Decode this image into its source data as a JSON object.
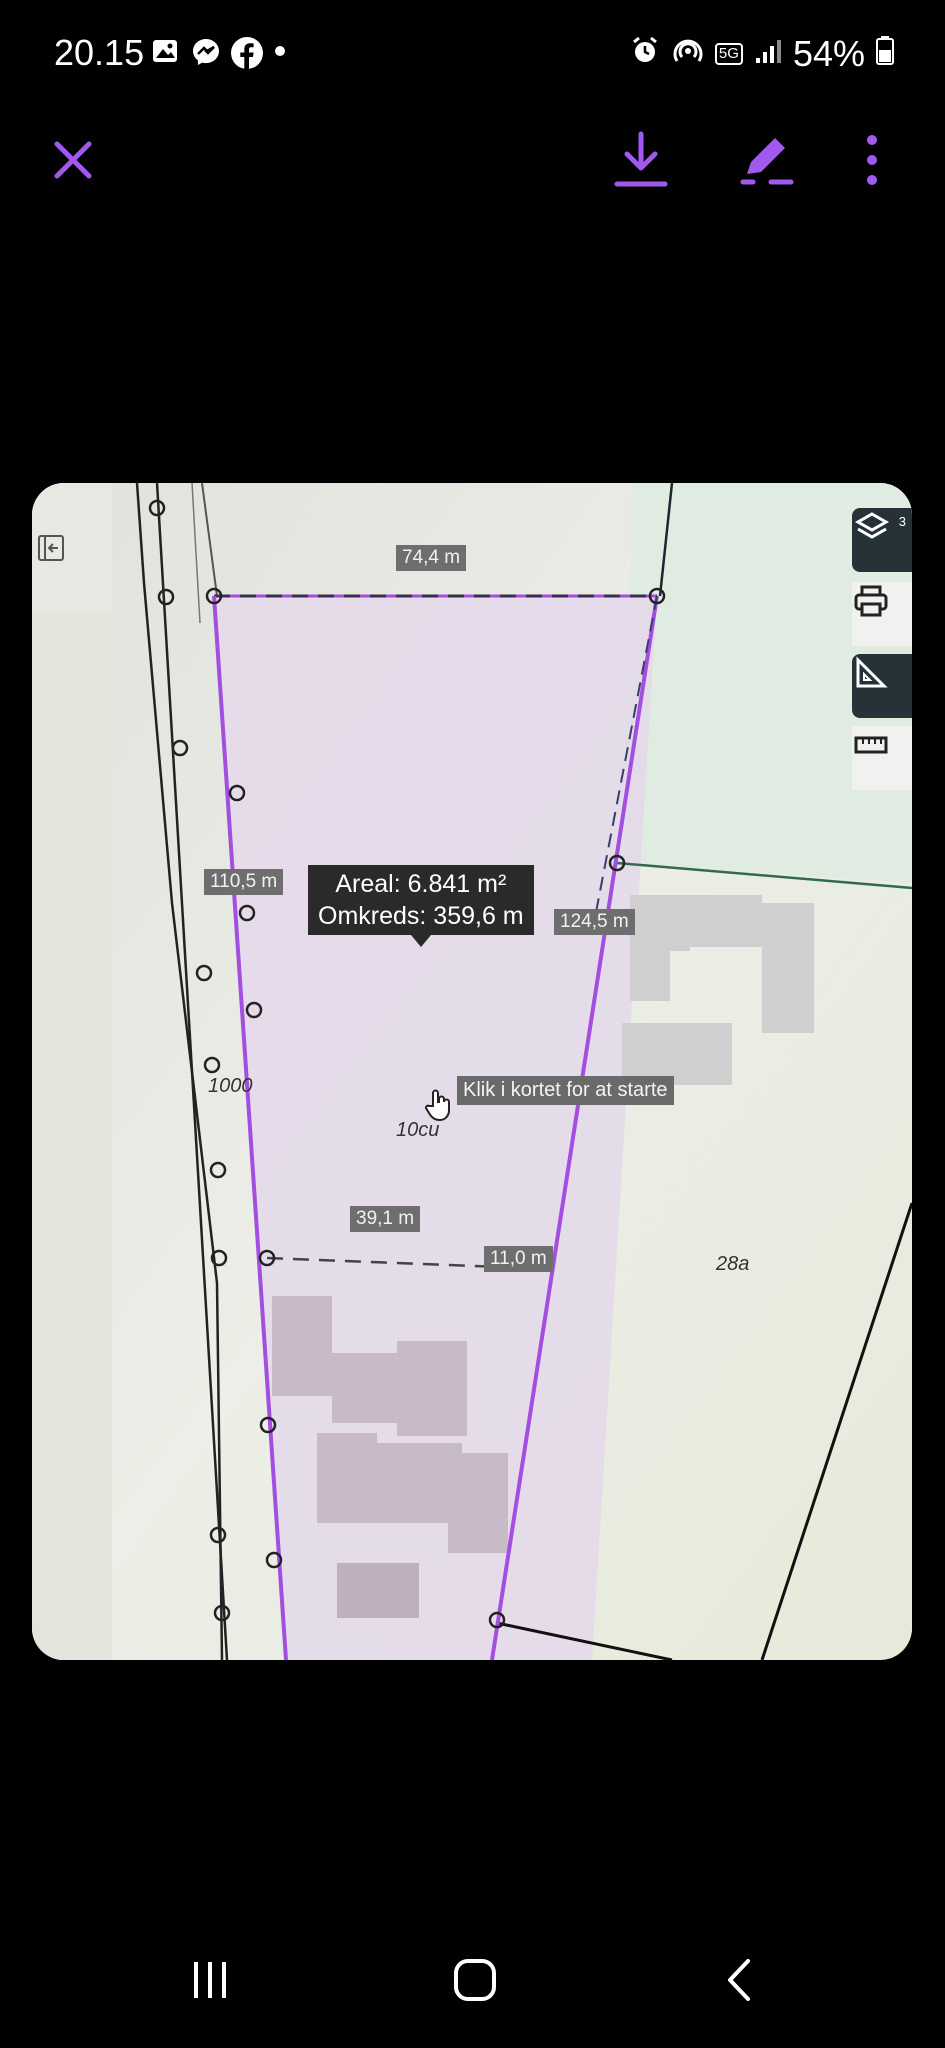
{
  "status": {
    "time": "20.15",
    "battery": "54%",
    "network": "5G",
    "icons": [
      "gallery-icon",
      "messenger-icon",
      "facebook-icon",
      "dot-icon",
      "alarm-icon",
      "hotspot-icon",
      "signal-icon",
      "battery-icon"
    ]
  },
  "toolbar": {
    "close_icon": "close-icon",
    "download_icon": "download-icon",
    "edit_icon": "edit-icon",
    "more_icon": "more-vert-icon",
    "accent": "#a259f0"
  },
  "map": {
    "dimension_labels": [
      "74,4 m",
      "110,5 m",
      "124,5 m",
      "39,1 m",
      "11,0 m"
    ],
    "area_label": "Areal: 6.841 m²",
    "perimeter_label": "Omkreds: 359,6 m",
    "hint": "Klik i kortet for at starte",
    "parcel_labels": [
      "1000",
      "10cu",
      "28a"
    ],
    "layers_count": "3",
    "polygon_color": "#a24ee0"
  },
  "nav": {
    "recents_icon": "recents-icon",
    "home_icon": "home-icon",
    "back_icon": "back-icon"
  }
}
